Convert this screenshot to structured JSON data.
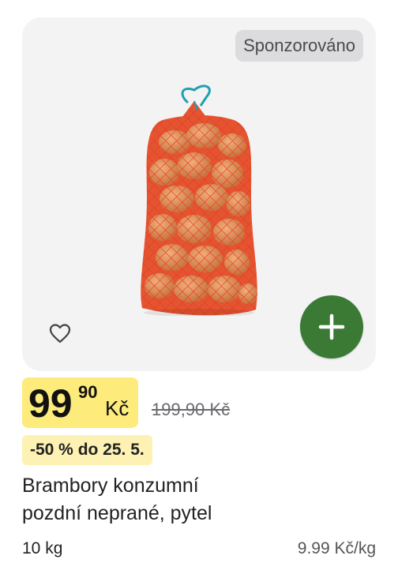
{
  "badge": {
    "sponsored": "Sponzorováno"
  },
  "price": {
    "integer": "99",
    "decimal": "90",
    "currency": "Kč",
    "original": "199,90 Kč"
  },
  "promo": {
    "label": "-50 % do 25. 5."
  },
  "product": {
    "name_line1": "Brambory konzumní",
    "name_line2": "pozdní neprané, pytel",
    "quantity": "10 kg",
    "unit_price": "9.99 Kč/kg"
  },
  "icons": {
    "favorite": "heart-icon",
    "add": "plus-icon"
  },
  "colors": {
    "price_highlight": "#fdeb7c",
    "promo_bg": "#fdf1b3",
    "add_button": "#3a7a35",
    "image_bg": "#f3f3f4"
  }
}
